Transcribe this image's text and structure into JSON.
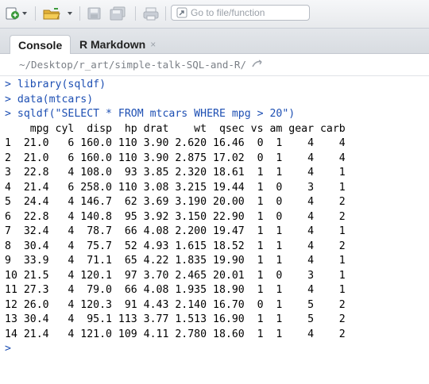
{
  "toolbar": {
    "goto_placeholder": "Go to file/function",
    "icons": [
      "new-file-icon",
      "open-folder-icon",
      "save-icon",
      "save-all-icon",
      "print-icon",
      "go-to-icon"
    ]
  },
  "tabs": [
    {
      "label": "Console",
      "active": true
    },
    {
      "label": "R Markdown",
      "active": false,
      "close": "×"
    }
  ],
  "path": "~/Desktop/r_art/simple-talk-SQL-and-R/",
  "console": {
    "prompt": ">",
    "commands": [
      "> library(sqldf)",
      "> data(mtcars)",
      "> sqldf(\"SELECT * FROM mtcars WHERE mpg > 20\")"
    ],
    "header": "    mpg cyl  disp  hp drat    wt  qsec vs am gear carb",
    "rows": [
      "1  21.0   6 160.0 110 3.90 2.620 16.46  0  1    4    4",
      "2  21.0   6 160.0 110 3.90 2.875 17.02  0  1    4    4",
      "3  22.8   4 108.0  93 3.85 2.320 18.61  1  1    4    1",
      "4  21.4   6 258.0 110 3.08 3.215 19.44  1  0    3    1",
      "5  24.4   4 146.7  62 3.69 3.190 20.00  1  0    4    2",
      "6  22.8   4 140.8  95 3.92 3.150 22.90  1  0    4    2",
      "7  32.4   4  78.7  66 4.08 2.200 19.47  1  1    4    1",
      "8  30.4   4  75.7  52 4.93 1.615 18.52  1  1    4    2",
      "9  33.9   4  71.1  65 4.22 1.835 19.90  1  1    4    1",
      "10 21.5   4 120.1  97 3.70 2.465 20.01  1  0    3    1",
      "11 27.3   4  79.0  66 4.08 1.935 18.90  1  1    4    1",
      "12 26.0   4 120.3  91 4.43 2.140 16.70  0  1    5    2",
      "13 30.4   4  95.1 113 3.77 1.513 16.90  1  1    5    2",
      "14 21.4   4 121.0 109 4.11 2.780 18.60  1  1    4    2"
    ]
  }
}
